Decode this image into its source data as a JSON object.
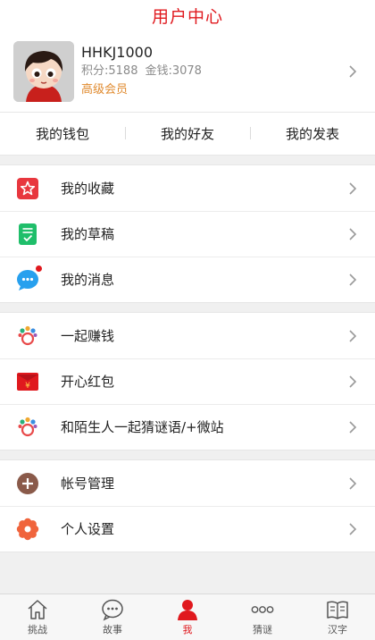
{
  "header": {
    "title": "用户中心"
  },
  "profile": {
    "username": "HHKJ1000",
    "points_label": "积分:5188",
    "money_label": "金钱:3078",
    "member_level": "高级会员"
  },
  "quick_links": [
    {
      "label": "我的钱包"
    },
    {
      "label": "我的好友"
    },
    {
      "label": "我的发表"
    }
  ],
  "groups": [
    {
      "items": [
        {
          "label": "我的收藏",
          "icon": "star-icon",
          "color": "#e8373e"
        },
        {
          "label": "我的草稿",
          "icon": "draft-icon",
          "color": "#1fbe6a"
        },
        {
          "label": "我的消息",
          "icon": "message-icon",
          "color": "#27a0ee",
          "badge": true
        }
      ]
    },
    {
      "items": [
        {
          "label": "一起赚钱",
          "icon": "coins-icon",
          "color": "#e84a4a"
        },
        {
          "label": "开心红包",
          "icon": "red-envelope-icon",
          "color": "#e0191e"
        },
        {
          "label": "和陌生人一起猜谜语/+微站",
          "icon": "puzzle-icon",
          "color": "#e84a4a"
        }
      ]
    },
    {
      "items": [
        {
          "label": "帐号管理",
          "icon": "account-icon",
          "color": "#8a5a4a"
        },
        {
          "label": "个人设置",
          "icon": "settings-icon",
          "color": "#f0643c"
        }
      ]
    }
  ],
  "tabbar": [
    {
      "label": "挑战",
      "icon": "home-icon",
      "active": false
    },
    {
      "label": "故事",
      "icon": "chat-icon",
      "active": false
    },
    {
      "label": "我",
      "icon": "user-icon",
      "active": true
    },
    {
      "label": "猜谜",
      "icon": "dots-icon",
      "active": false
    },
    {
      "label": "汉字",
      "icon": "book-icon",
      "active": false
    }
  ],
  "colors": {
    "accent": "#e0191e",
    "member": "#e08a2e"
  }
}
